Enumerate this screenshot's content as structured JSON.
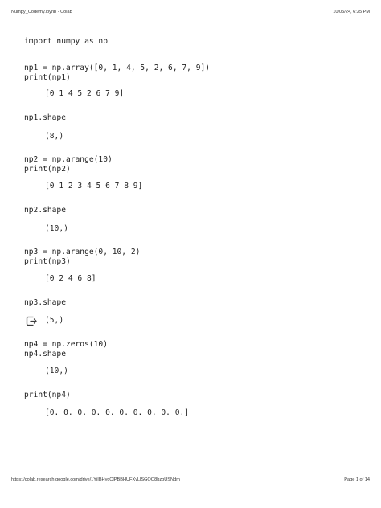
{
  "header": {
    "title": "Numpy_Codemy.ipynb - Colab",
    "datetime": "10/05/24, 6:35 PM"
  },
  "footer": {
    "url": "https://colab.research.google.com/drive/1YjIBHycCIPBBHUFXyLlSGOQ8bzbUSNdm",
    "page": "Page 1 of 14"
  },
  "cells": [
    {
      "code": "import numpy as np"
    },
    {
      "code": "np1 = np.array([0, 1, 4, 5, 2, 6, 7, 9])\nprint(np1)",
      "output": "[0 1 4 5 2 6 7 9]"
    },
    {
      "code": "np1.shape",
      "output": "(8,)"
    },
    {
      "code": "np2 = np.arange(10)\nprint(np2)",
      "output": "[0 1 2 3 4 5 6 7 8 9]"
    },
    {
      "code": "np2.shape",
      "output": "(10,)"
    },
    {
      "code": "np3 = np.arange(0, 10, 2)\nprint(np3)",
      "output": "[0 2 4 6 8]"
    },
    {
      "code": "np3.shape",
      "output": "(5,)",
      "output_icon": "output-redirect-icon"
    },
    {
      "code": "np4 = np.zeros(10)\nnp4.shape",
      "output": "(10,)"
    },
    {
      "code": "print(np4)",
      "output": "[0. 0. 0. 0. 0. 0. 0. 0. 0. 0.]"
    }
  ]
}
